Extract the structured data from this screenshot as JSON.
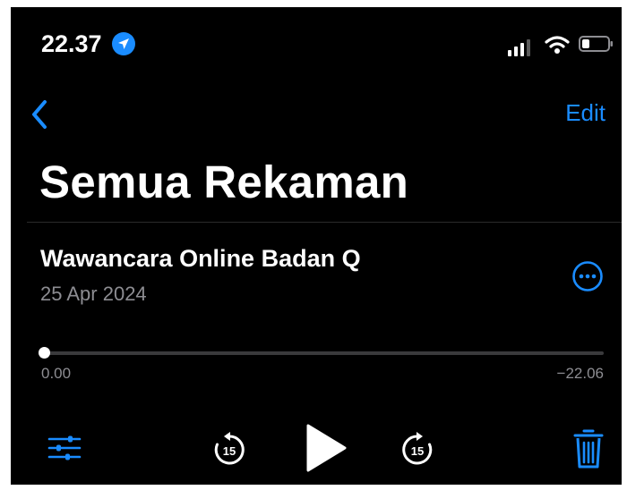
{
  "status_bar": {
    "time": "22.37",
    "icons": [
      "location-arrow-icon",
      "cellular-signal-icon",
      "wifi-icon",
      "battery-icon"
    ]
  },
  "nav": {
    "back_icon": "chevron-left-icon",
    "edit_label": "Edit"
  },
  "page": {
    "title": "Semua Rekaman"
  },
  "recording": {
    "title": "Wawancara Online Badan Q",
    "date": "25 Apr 2024",
    "more_icon": "ellipsis-circle-icon"
  },
  "player": {
    "elapsed": "0.00",
    "remaining": "−22.06",
    "progress": 0.0,
    "skip_back_seconds": "15",
    "skip_forward_seconds": "15",
    "icons": [
      "sliders-icon",
      "rewind-15-icon",
      "play-icon",
      "forward-15-icon",
      "trash-icon"
    ]
  },
  "colors": {
    "background": "#000000",
    "accent": "#1a8cff",
    "text_primary": "#ffffff",
    "text_secondary": "#8d8d92",
    "track": "#3a3a3c"
  }
}
